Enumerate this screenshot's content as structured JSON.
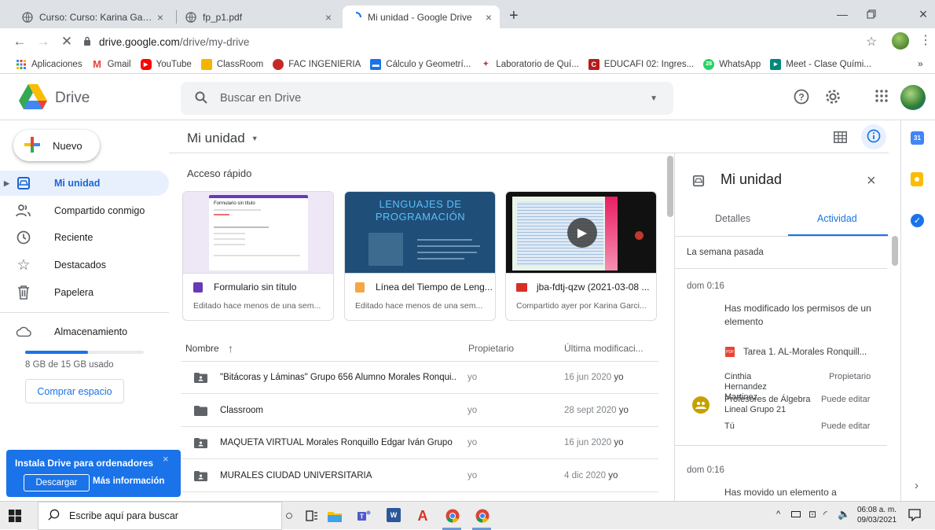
{
  "browser": {
    "tabs": [
      {
        "title": "Curso: Curso: Karina Garcia Mora"
      },
      {
        "title": "fp_p1.pdf"
      },
      {
        "title": "Mi unidad - Google Drive"
      }
    ],
    "url_host": "drive.google.com",
    "url_path": "/drive/my-drive",
    "bookmarks": [
      {
        "label": "Aplicaciones",
        "color": "#4285f4"
      },
      {
        "label": "Gmail",
        "color": "#ea4335"
      },
      {
        "label": "YouTube",
        "color": "#ff0000"
      },
      {
        "label": "ClassRoom",
        "color": "#f4b400"
      },
      {
        "label": "FAC INGENIERIA",
        "color": "#c62828"
      },
      {
        "label": "Cálculo y Geometrí...",
        "color": "#1a73e8"
      },
      {
        "label": "Laboratorio de Quí...",
        "color": "#d32f2f"
      },
      {
        "label": "EDUCAFI 02: Ingres...",
        "color": "#b71c1c"
      },
      {
        "label": "WhatsApp",
        "color": "#25d366"
      },
      {
        "label": "Meet - Clase Quími...",
        "color": "#00897b"
      }
    ],
    "bookmarks_more": "»"
  },
  "drive": {
    "logo_text": "Drive",
    "search_placeholder": "Buscar en Drive",
    "new_button": "Nuevo",
    "nav": [
      {
        "label": "Mi unidad",
        "icon": "my-drive-icon"
      },
      {
        "label": "Compartido conmigo",
        "icon": "shared-icon"
      },
      {
        "label": "Reciente",
        "icon": "clock-icon"
      },
      {
        "label": "Destacados",
        "icon": "star-icon"
      },
      {
        "label": "Papelera",
        "icon": "trash-icon"
      }
    ],
    "storage": {
      "label": "Almacenamiento",
      "used_text": "8 GB de 15 GB usado",
      "used_fraction": 0.53,
      "buy_button": "Comprar espacio"
    },
    "install_banner": {
      "title": "Instala Drive para ordenadores",
      "download": "Descargar",
      "more": "Más información"
    },
    "main": {
      "title": "Mi unidad",
      "quick_access_title": "Acceso rápido",
      "quick": [
        {
          "name": "Formulario sin título",
          "sub": "Editado hace menos de una sem...",
          "icon_color": "#673ab7",
          "thumb": {
            "form_title": "Formulario sin título"
          }
        },
        {
          "name": "Línea del Tiempo de Leng...",
          "sub": "Editado hace menos de una sem...",
          "icon_color": "#f4a742",
          "thumb": {
            "line1": "LENGUAJES DE",
            "line2": "PROGRAMACIÓN"
          }
        },
        {
          "name": "jba-fdtj-qzw (2021-03-08 ...",
          "sub": "Compartido ayer por Karina Garci...",
          "icon_color": "#d93025"
        }
      ],
      "columns": {
        "name": "Nombre",
        "sort_arrow": "↑",
        "owner": "Propietario",
        "modified": "Última modificaci..."
      },
      "files": [
        {
          "name": "\"Bitácoras y Láminas\" Grupo 656 Alumno Morales Ronqui...",
          "owner": "yo",
          "date": "16 jun 2020",
          "by": "yo",
          "shared": true
        },
        {
          "name": "Classroom",
          "owner": "yo",
          "date": "28 sept 2020",
          "by": "yo",
          "shared": false
        },
        {
          "name": "MAQUETA VIRTUAL Morales Ronquillo Edgar Iván Grupo ...",
          "owner": "yo",
          "date": "16 jun 2020",
          "by": "yo",
          "shared": true
        },
        {
          "name": "MURALES CIUDAD UNIVERSITARIA",
          "owner": "yo",
          "date": "4 dic 2020",
          "by": "yo",
          "shared": true
        }
      ]
    },
    "panel": {
      "title": "Mi unidad",
      "tab_details": "Detalles",
      "tab_activity": "Actividad",
      "section": "La semana pasada",
      "entries": [
        {
          "time": "dom 0:16",
          "text": "Has modificado los permisos de un elemento",
          "file": "Tarea 1. AL-Morales Ronquill...",
          "perms": [
            {
              "who": "Cinthia Hernandez Martinez",
              "role": "Propietario"
            },
            {
              "who": "Profesores de Álgebra Lineal Grupo 21",
              "role": "Puede editar"
            },
            {
              "who": "Tú",
              "role": "Puede editar"
            }
          ]
        },
        {
          "time": "dom 0:16",
          "text": "Has movido un elemento a"
        }
      ]
    }
  },
  "taskbar": {
    "search_placeholder": "Escribe aquí para buscar",
    "time": "06:08 a. m.",
    "date": "09/03/2021"
  }
}
